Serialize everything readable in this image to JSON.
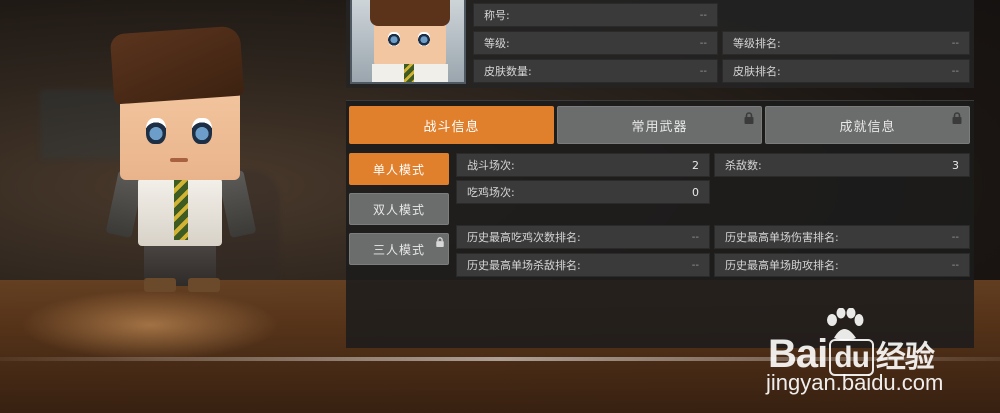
{
  "profile": {
    "fields": [
      {
        "label": "称号:",
        "value": "--"
      },
      {
        "label": "等级:",
        "value": "--"
      },
      {
        "label": "等级排名:",
        "value": "--"
      },
      {
        "label": "皮肤数量:",
        "value": "--"
      },
      {
        "label": "皮肤排名:",
        "value": "--"
      }
    ]
  },
  "tabs": [
    {
      "label": "战斗信息",
      "active": true
    },
    {
      "label": "常用武器",
      "locked": true
    },
    {
      "label": "成就信息",
      "locked": true
    }
  ],
  "modes": [
    {
      "label": "单人模式",
      "active": true
    },
    {
      "label": "双人模式"
    },
    {
      "label": "三人模式",
      "locked": true
    }
  ],
  "stats": {
    "battles": {
      "label": "战斗场次:",
      "value": "2"
    },
    "kills": {
      "label": "杀敌数:",
      "value": "3"
    },
    "chicken_dinners": {
      "label": "吃鸡场次:",
      "value": "0"
    },
    "best_dinner_rank": {
      "label": "历史最高吃鸡次数排名:",
      "value": "--"
    },
    "best_damage_rank": {
      "label": "历史最高单场伤害排名:",
      "value": "--"
    },
    "best_kill_rank": {
      "label": "历史最高单场杀敌排名:",
      "value": "--"
    },
    "best_assist_rank": {
      "label": "历史最高单场助攻排名:",
      "value": "--"
    }
  },
  "watermark": {
    "logo_text_a": "Bai",
    "logo_text_b": "du",
    "logo_text_c": "经验",
    "url": "jingyan.baidu.com"
  },
  "colors": {
    "accent": "#e07f2c",
    "inactive_button": "#6b6c6c",
    "field_bg": "#3a3a3a"
  },
  "icons": [
    "lock-icon",
    "baidu-paw-icon"
  ]
}
